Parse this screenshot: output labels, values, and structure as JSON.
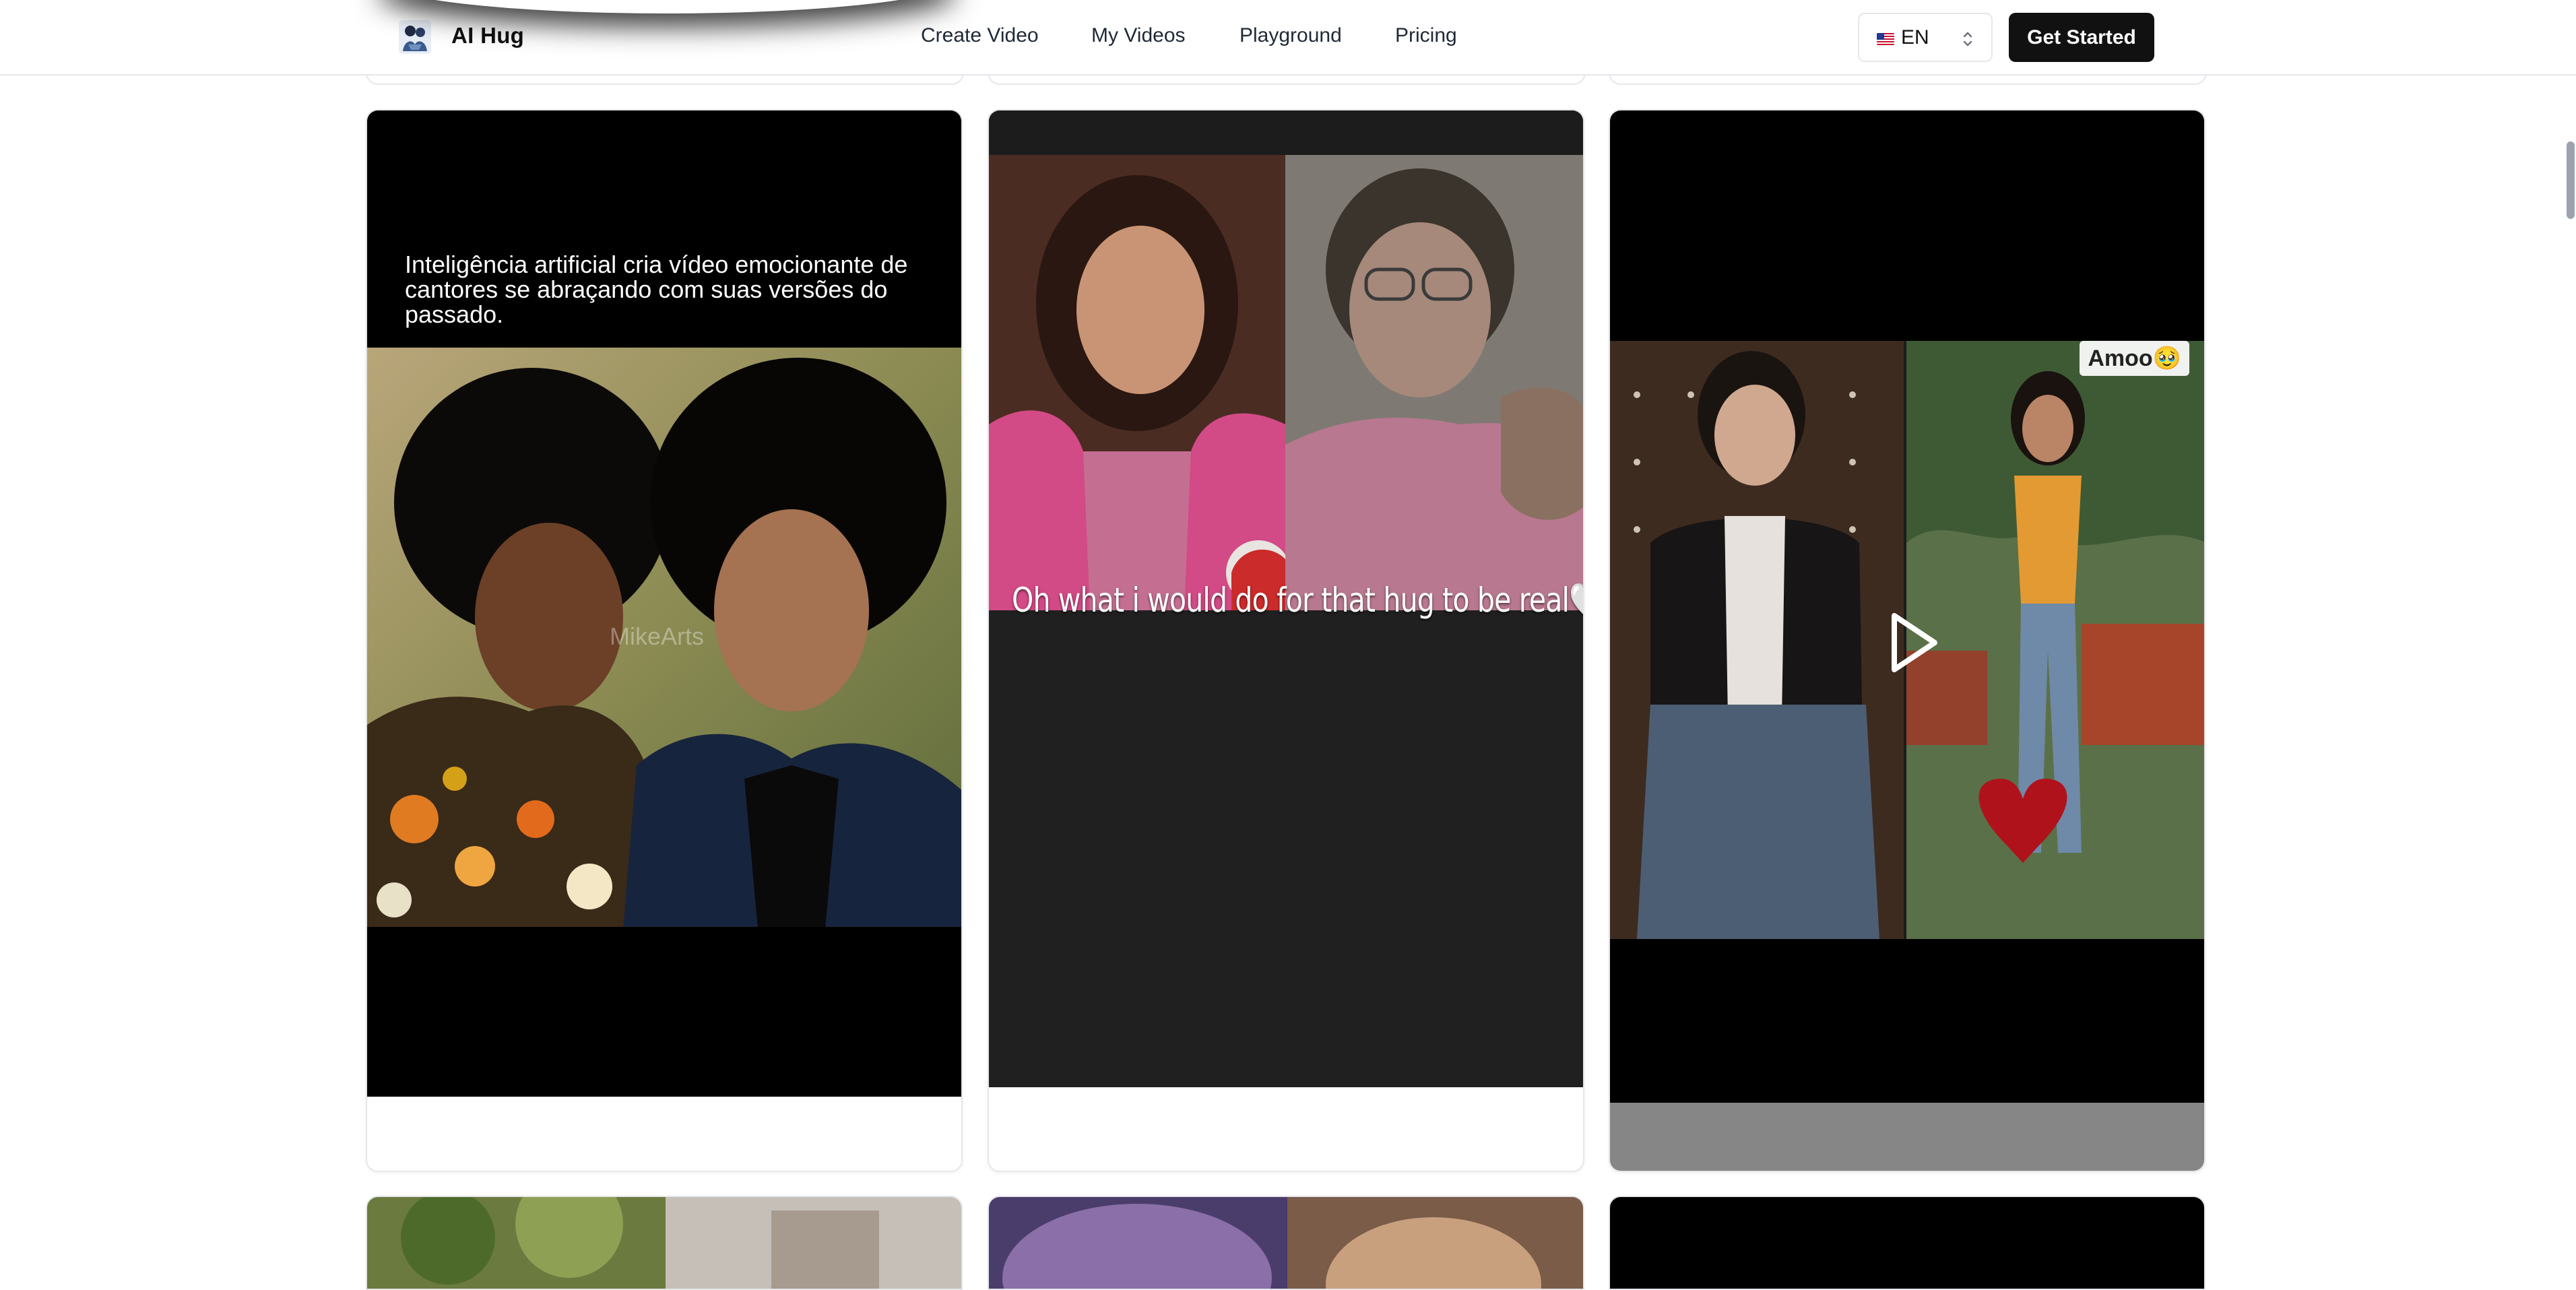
{
  "header": {
    "brand": "AI Hug",
    "nav": [
      "Create Video",
      "My Videos",
      "Playground",
      "Pricing"
    ],
    "language": "EN",
    "cta": "Get Started"
  },
  "cards": [
    {
      "caption": "Inteligência artificial cria vídeo emocionante de cantores se abraçando com suas versões do passado.",
      "watermark": "MikeArts"
    },
    {
      "caption": "Oh what i would do for that hug to be real🤍"
    },
    {
      "sticker": "Amoo🥹"
    }
  ],
  "colors": {
    "accent": "#111111",
    "border": "#e5e7eb"
  }
}
